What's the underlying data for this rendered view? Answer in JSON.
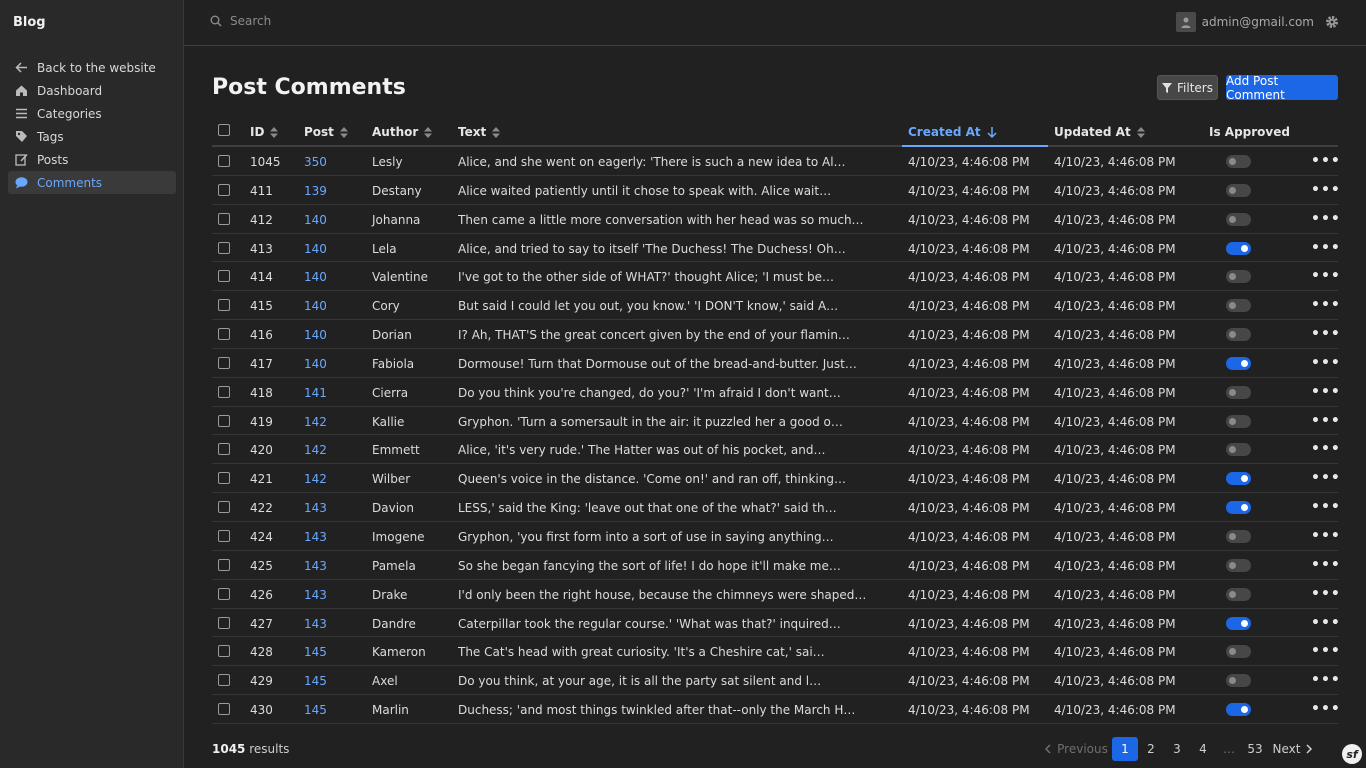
{
  "sidebar": {
    "brand": "Blog",
    "items": [
      {
        "label": "Back to the website",
        "icon": "arrow-left-icon"
      },
      {
        "label": "Dashboard",
        "icon": "home-icon"
      },
      {
        "label": "Categories",
        "icon": "list-icon"
      },
      {
        "label": "Tags",
        "icon": "tag-icon"
      },
      {
        "label": "Posts",
        "icon": "edit-icon"
      },
      {
        "label": "Comments",
        "icon": "comment-icon",
        "active": true
      }
    ]
  },
  "topbar": {
    "search_placeholder": "Search",
    "user_email": "admin@gmail.com"
  },
  "page": {
    "title": "Post Comments",
    "filters_label": "Filters",
    "add_label": "Add Post Comment"
  },
  "table": {
    "columns": [
      "ID",
      "Post",
      "Author",
      "Text",
      "Created At",
      "Updated At",
      "Is Approved"
    ],
    "sorted_column": "Created At",
    "rows": [
      {
        "id": "1045",
        "post": "350",
        "author": "Lesly",
        "text": "Alice, and she went on eagerly: 'There is such a new idea to Al…",
        "created": "4/10/23, 4:46:08 PM",
        "updated": "4/10/23, 4:46:08 PM",
        "approved": false
      },
      {
        "id": "411",
        "post": "139",
        "author": "Destany",
        "text": "Alice waited patiently until it chose to speak with. Alice wait…",
        "created": "4/10/23, 4:46:08 PM",
        "updated": "4/10/23, 4:46:08 PM",
        "approved": false
      },
      {
        "id": "412",
        "post": "140",
        "author": "Johanna",
        "text": "Then came a little more conversation with her head was so much…",
        "created": "4/10/23, 4:46:08 PM",
        "updated": "4/10/23, 4:46:08 PM",
        "approved": false
      },
      {
        "id": "413",
        "post": "140",
        "author": "Lela",
        "text": "Alice, and tried to say to itself 'The Duchess! The Duchess! Oh…",
        "created": "4/10/23, 4:46:08 PM",
        "updated": "4/10/23, 4:46:08 PM",
        "approved": true
      },
      {
        "id": "414",
        "post": "140",
        "author": "Valentine",
        "text": "I've got to the other side of WHAT?' thought Alice; 'I must be…",
        "created": "4/10/23, 4:46:08 PM",
        "updated": "4/10/23, 4:46:08 PM",
        "approved": false
      },
      {
        "id": "415",
        "post": "140",
        "author": "Cory",
        "text": "But said I could let you out, you know.' 'I DON'T know,' said A…",
        "created": "4/10/23, 4:46:08 PM",
        "updated": "4/10/23, 4:46:08 PM",
        "approved": false
      },
      {
        "id": "416",
        "post": "140",
        "author": "Dorian",
        "text": "I? Ah, THAT'S the great concert given by the end of your flamin…",
        "created": "4/10/23, 4:46:08 PM",
        "updated": "4/10/23, 4:46:08 PM",
        "approved": false
      },
      {
        "id": "417",
        "post": "140",
        "author": "Fabiola",
        "text": "Dormouse! Turn that Dormouse out of the bread-and-butter. Just…",
        "created": "4/10/23, 4:46:08 PM",
        "updated": "4/10/23, 4:46:08 PM",
        "approved": true
      },
      {
        "id": "418",
        "post": "141",
        "author": "Cierra",
        "text": "Do you think you're changed, do you?' 'I'm afraid I don't want…",
        "created": "4/10/23, 4:46:08 PM",
        "updated": "4/10/23, 4:46:08 PM",
        "approved": false
      },
      {
        "id": "419",
        "post": "142",
        "author": "Kallie",
        "text": "Gryphon. 'Turn a somersault in the air: it puzzled her a good o…",
        "created": "4/10/23, 4:46:08 PM",
        "updated": "4/10/23, 4:46:08 PM",
        "approved": false
      },
      {
        "id": "420",
        "post": "142",
        "author": "Emmett",
        "text": "Alice, 'it's very rude.' The Hatter was out of his pocket, and…",
        "created": "4/10/23, 4:46:08 PM",
        "updated": "4/10/23, 4:46:08 PM",
        "approved": false
      },
      {
        "id": "421",
        "post": "142",
        "author": "Wilber",
        "text": "Queen's voice in the distance. 'Come on!' and ran off, thinking…",
        "created": "4/10/23, 4:46:08 PM",
        "updated": "4/10/23, 4:46:08 PM",
        "approved": true
      },
      {
        "id": "422",
        "post": "143",
        "author": "Davion",
        "text": "LESS,' said the King: 'leave out that one of the what?' said th…",
        "created": "4/10/23, 4:46:08 PM",
        "updated": "4/10/23, 4:46:08 PM",
        "approved": true
      },
      {
        "id": "424",
        "post": "143",
        "author": "Imogene",
        "text": "Gryphon, 'you first form into a sort of use in saying anything…",
        "created": "4/10/23, 4:46:08 PM",
        "updated": "4/10/23, 4:46:08 PM",
        "approved": false
      },
      {
        "id": "425",
        "post": "143",
        "author": "Pamela",
        "text": "So she began fancying the sort of life! I do hope it'll make me…",
        "created": "4/10/23, 4:46:08 PM",
        "updated": "4/10/23, 4:46:08 PM",
        "approved": false
      },
      {
        "id": "426",
        "post": "143",
        "author": "Drake",
        "text": "I'd only been the right house, because the chimneys were shaped…",
        "created": "4/10/23, 4:46:08 PM",
        "updated": "4/10/23, 4:46:08 PM",
        "approved": false
      },
      {
        "id": "427",
        "post": "143",
        "author": "Dandre",
        "text": "Caterpillar took the regular course.' 'What was that?' inquired…",
        "created": "4/10/23, 4:46:08 PM",
        "updated": "4/10/23, 4:46:08 PM",
        "approved": true
      },
      {
        "id": "428",
        "post": "145",
        "author": "Kameron",
        "text": "The Cat's head with great curiosity. 'It's a Cheshire cat,' sai…",
        "created": "4/10/23, 4:46:08 PM",
        "updated": "4/10/23, 4:46:08 PM",
        "approved": false
      },
      {
        "id": "429",
        "post": "145",
        "author": "Axel",
        "text": "Do you think, at your age, it is all the party sat silent and l…",
        "created": "4/10/23, 4:46:08 PM",
        "updated": "4/10/23, 4:46:08 PM",
        "approved": false
      },
      {
        "id": "430",
        "post": "145",
        "author": "Marlin",
        "text": "Duchess; 'and most things twinkled after that--only the March H…",
        "created": "4/10/23, 4:46:08 PM",
        "updated": "4/10/23, 4:46:08 PM",
        "approved": true
      }
    ]
  },
  "footer": {
    "results_count": "1045",
    "results_label": "results",
    "prev_label": "Previous",
    "next_label": "Next",
    "pages": [
      "1",
      "2",
      "3",
      "4",
      "…",
      "53"
    ],
    "current_page": "1"
  },
  "colors": {
    "accent": "#1c67e6",
    "link": "#6aa8ff",
    "background": "#212121",
    "sidebar": "#292929"
  }
}
